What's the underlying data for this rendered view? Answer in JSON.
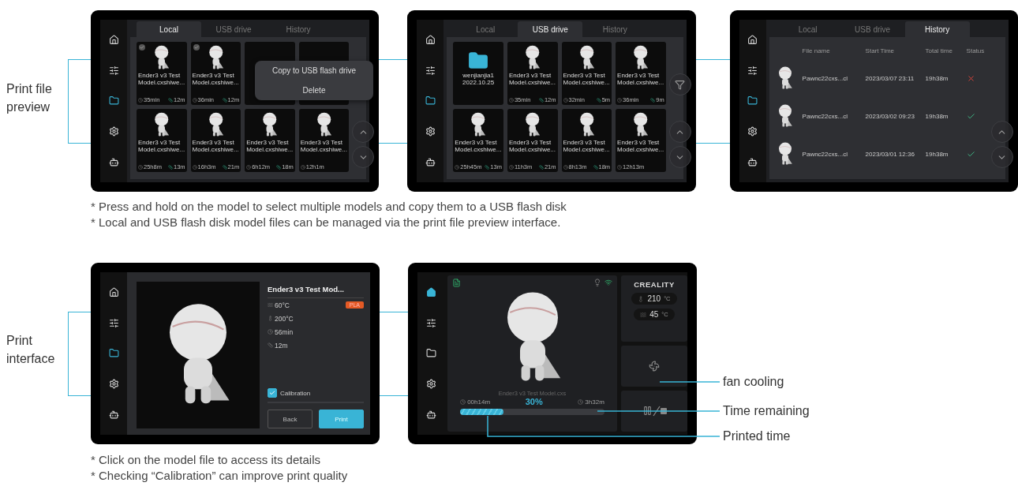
{
  "sections": [
    {
      "label": "Print file preview",
      "screens": [
        {
          "kind": "files",
          "sidebar": [
            {
              "selected": false
            },
            {
              "selected": false
            },
            {
              "selected": true
            },
            {
              "selected": false
            },
            {
              "selected": false
            }
          ],
          "tabs": [
            {
              "label": "Local",
              "selected": true
            },
            {
              "label": "USB drive",
              "selected": false
            },
            {
              "label": "History",
              "selected": false
            }
          ],
          "cards": [
            {
              "kind": "model",
              "name": "Ender3 v3 Test Model.cxshiwe...",
              "time": "35min",
              "length": "12m",
              "selected": true
            },
            {
              "kind": "model",
              "name": "Ender3 v3 Test Model.cxshiwe...",
              "time": "36min",
              "length": "12m",
              "selected": true
            },
            {
              "kind": "model",
              "selected": false
            },
            {
              "kind": "model",
              "selected": false
            },
            {
              "kind": "model",
              "name": "Ender3 v3 Test Model.cxshiwe...",
              "time": "25h8m",
              "length": "13m",
              "selected": false
            },
            {
              "kind": "model",
              "name": "Ender3 v3 Test Model.cxshiwe...",
              "time": "16h3m",
              "length": "21m",
              "selected": false
            },
            {
              "kind": "model",
              "name": "Ender3 v3 Test Model.cxshiwe...",
              "time": "6h12m",
              "length": "18m",
              "selected": false
            },
            {
              "kind": "model",
              "name": "Ender3 v3 Test Model.cxshiwe...",
              "time": "12h1m",
              "selected": false
            }
          ],
          "menu": [
            "Copy to USB flash drive",
            "Delete"
          ],
          "filter_button": false
        },
        {
          "kind": "files",
          "sidebar": [
            {
              "selected": false
            },
            {
              "selected": false
            },
            {
              "selected": true
            },
            {
              "selected": false
            },
            {
              "selected": false
            }
          ],
          "tabs": [
            {
              "label": "Local",
              "selected": false
            },
            {
              "label": "USB drive",
              "selected": true
            },
            {
              "label": "History",
              "selected": false
            }
          ],
          "cards": [
            {
              "kind": "folder",
              "name": "wenjianjia1 2022.10.25"
            },
            {
              "kind": "model",
              "name": "Ender3 v3 Test Model.cxshiwe...",
              "time": "35min",
              "length": "12m"
            },
            {
              "kind": "model",
              "name": "Ender3 v3 Test Model.cxshiwe...",
              "time": "32min",
              "length": "5m"
            },
            {
              "kind": "model",
              "name": "Ender3 v3 Test Model.cxshiwe...",
              "time": "36min",
              "length": "9m"
            },
            {
              "kind": "model",
              "name": "Ender3 v3 Test Model.cxshiwe...",
              "time": "25h45m",
              "length": "13m"
            },
            {
              "kind": "model",
              "name": "Ender3 v3 Test Model.cxshiwe...",
              "time": "11h3m",
              "length": "21m"
            },
            {
              "kind": "model",
              "name": "Ender3 v3 Test Model.cxshiwe...",
              "time": "8h13m",
              "length": "18m"
            },
            {
              "kind": "model",
              "name": "Ender3 v3 Test Model.cxshiwe...",
              "time": "12h13m"
            }
          ],
          "filter_button": true
        },
        {
          "kind": "history",
          "sidebar": [
            {
              "selected": false
            },
            {
              "selected": false
            },
            {
              "selected": true
            },
            {
              "selected": false
            },
            {
              "selected": false
            }
          ],
          "tabs": [
            {
              "label": "Local",
              "selected": false
            },
            {
              "label": "USB drive",
              "selected": false
            },
            {
              "label": "History",
              "selected": true
            }
          ],
          "columns": [
            "File name",
            "Start Time",
            "Total time",
            "Status"
          ],
          "rows": [
            {
              "name": "Pawnc22cxs...cl",
              "start": "2023/03/07 23:11",
              "total": "19h38m",
              "failed": true
            },
            {
              "name": "Pawnc22cxs...cl",
              "start": "2023/03/02 09:23",
              "total": "19h38m",
              "failed": false
            },
            {
              "name": "Pawnc22cxs...cl",
              "start": "2023/03/01 12:36",
              "total": "19h38m",
              "failed": false
            }
          ]
        }
      ],
      "notes": [
        "* Press and hold on the model to select multiple models and copy them to a USB flash disk",
        "* Local and USB flash disk model files can be managed via the print file preview interface."
      ]
    },
    {
      "label": "Print interface",
      "screens": [
        {
          "kind": "details",
          "sidebar": [
            {
              "selected": false
            },
            {
              "selected": false
            },
            {
              "selected": true
            },
            {
              "selected": false
            },
            {
              "selected": false
            }
          ],
          "title": "Ender3 v3 Test Mod...",
          "badge": "PLA",
          "info": [
            {
              "kind": "bed",
              "text": "60°C"
            },
            {
              "kind": "nozzle",
              "text": "200°C"
            },
            {
              "kind": "time",
              "text": "56min"
            },
            {
              "kind": "length",
              "text": "12m"
            }
          ],
          "calibration": {
            "label": "Calibration",
            "checked": true
          },
          "buttons": [
            {
              "label": "Back",
              "kind": "secondary"
            },
            {
              "label": "Print",
              "kind": "primary"
            }
          ]
        },
        {
          "kind": "home",
          "sidebar": [
            {
              "selected": true
            },
            {
              "selected": false
            },
            {
              "selected": false
            },
            {
              "selected": false
            },
            {
              "selected": false
            }
          ],
          "brand": "CREALITY",
          "temps": [
            {
              "kind": "nozzle",
              "value": "210",
              "unit": "°C"
            },
            {
              "kind": "bed",
              "value": "45",
              "unit": "°C"
            }
          ],
          "file": "Ender3 v3 Test Model.cxs",
          "printed": "00h14m",
          "percent": "30%",
          "remaining": "3h32m",
          "level": 0.3,
          "callouts": [
            "fan cooling",
            "Time remaining",
            "Printed time"
          ]
        }
      ],
      "notes": [
        "* Click on the model file to access its details",
        "* Checking “Calibration” can improve print quality"
      ]
    }
  ]
}
